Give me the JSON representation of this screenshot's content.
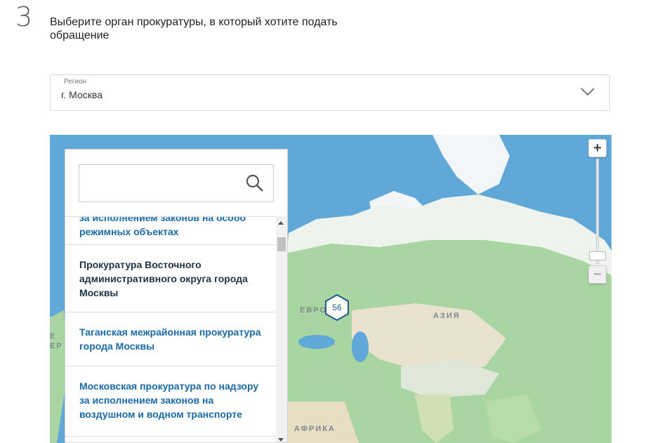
{
  "step": {
    "number": "3",
    "title": "Выберите орган прокуратуры, в который хотите подать обращение"
  },
  "region": {
    "label": "Регион",
    "value": "г. Москва",
    "icon": "chevron-down-icon"
  },
  "map": {
    "labels": {
      "europe": "ЕВРОПА",
      "asia": "АЗИЯ",
      "africa": "АФРИКА",
      "partial_left": "Е\nЕР"
    },
    "cluster_count": "56",
    "zoom": {
      "plus": "+",
      "minus": "−"
    },
    "colors": {
      "water": "#5fa8d8",
      "land": "#a8d5a2",
      "ice": "#f2f6f8",
      "desert": "#e9e2cf"
    }
  },
  "search": {
    "placeholder": "",
    "icon": "search-icon"
  },
  "list": {
    "items": [
      {
        "text": "за исполнением законов на особо режимных объектах",
        "style": "link"
      },
      {
        "text": "Прокуратура Восточного административного округа города Москвы",
        "style": "dark"
      },
      {
        "text": "Таганская межрайонная прокуратура города Москвы",
        "style": "link"
      },
      {
        "text": "Московская прокуратура по надзору за исполнением законов на воздушном и водном транспорте",
        "style": "link"
      }
    ]
  }
}
